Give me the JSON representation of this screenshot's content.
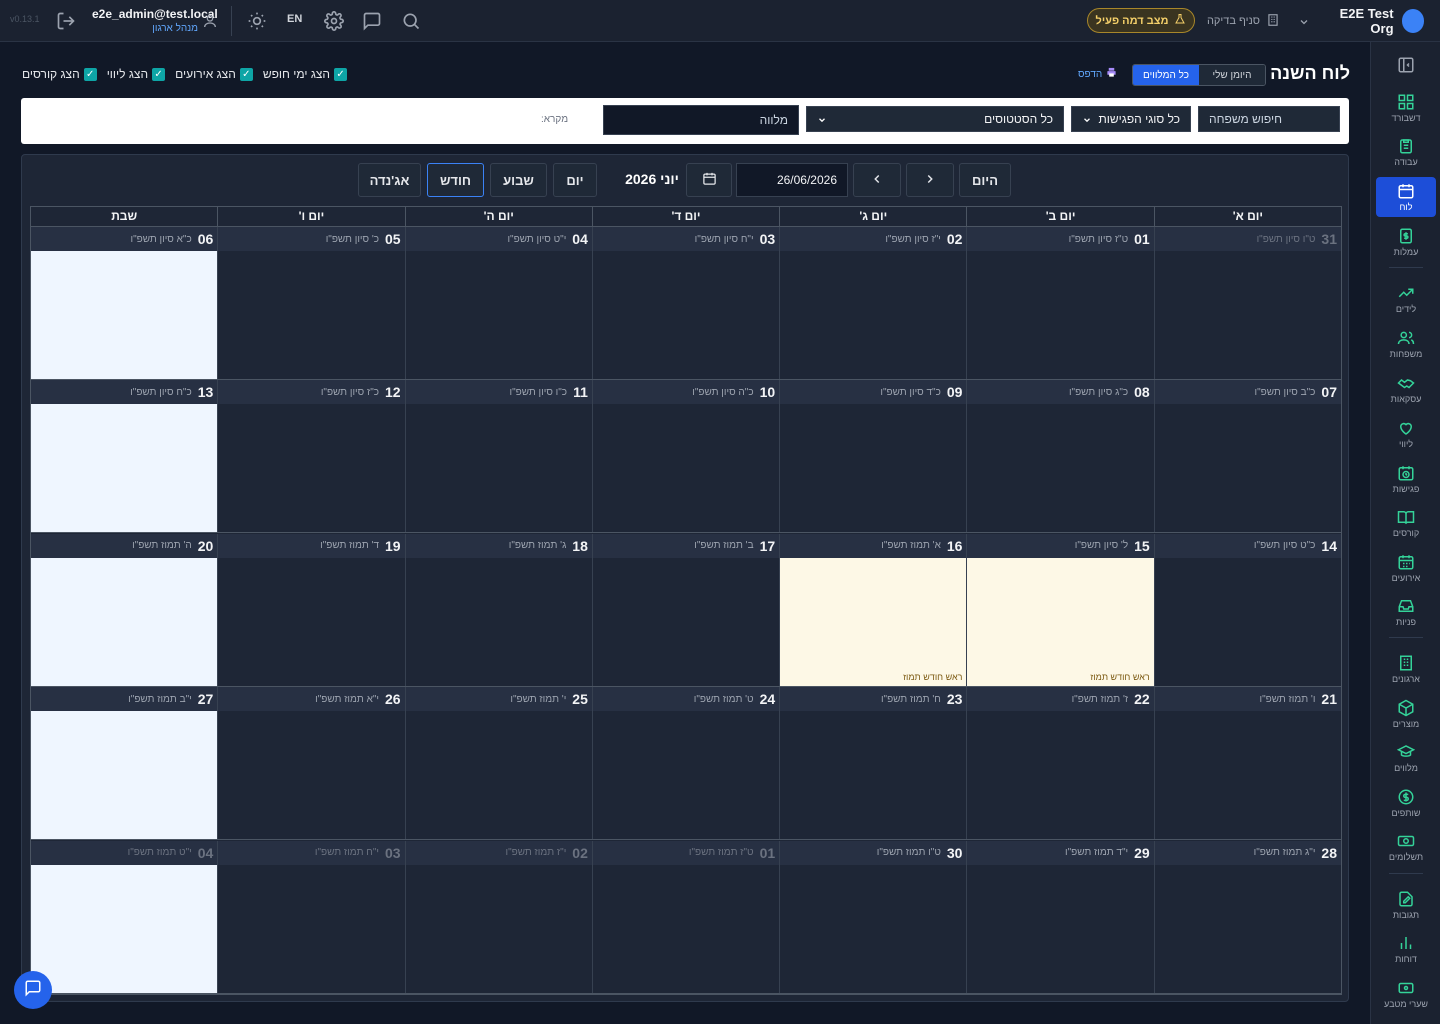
{
  "topbar": {
    "version": "v0.13.1",
    "user_email": "e2e_admin@test.local",
    "user_role": "מנהל ארגון",
    "lang": "EN",
    "demo_mode": "מצב דמה פעיל",
    "branch": "סניף בדיקה",
    "org_name": "E2E Test Org"
  },
  "sidebar": {
    "items": [
      {
        "label": "דשבורד",
        "icon": "dashboard-icon"
      },
      {
        "label": "עבודה",
        "icon": "clipboard-icon"
      },
      {
        "label": "לוח",
        "icon": "calendar-icon",
        "active": true
      },
      {
        "label": "עמלות",
        "icon": "dollar-doc-icon"
      },
      {
        "label": "לידים",
        "icon": "trending-icon"
      },
      {
        "label": "משפחות",
        "icon": "users-icon"
      },
      {
        "label": "עסקאות",
        "icon": "handshake-icon"
      },
      {
        "label": "ליווי",
        "icon": "heart-hand-icon"
      },
      {
        "label": "פגישות",
        "icon": "calendar-clock-icon"
      },
      {
        "label": "קורסים",
        "icon": "book-icon"
      },
      {
        "label": "אירועים",
        "icon": "calendar-grid-icon"
      },
      {
        "label": "פניות",
        "icon": "inbox-icon"
      },
      {
        "label": "ארגונים",
        "icon": "building-icon"
      },
      {
        "label": "מוצרים",
        "icon": "box-icon"
      },
      {
        "label": "מלווים",
        "icon": "graduation-cap-icon"
      },
      {
        "label": "שותפים",
        "icon": "coin-icon"
      },
      {
        "label": "תשלומים",
        "icon": "money-icon"
      },
      {
        "label": "תגובות",
        "icon": "edit-doc-icon"
      },
      {
        "label": "דוחות",
        "icon": "bar-chart-icon"
      },
      {
        "label": "שערי מטבע",
        "icon": "cash-icon"
      }
    ]
  },
  "header": {
    "title": "לוח השנה",
    "view_mine": "היומן שלי",
    "view_all": "כל המלווים",
    "print": "הדפס",
    "toggles": [
      "הצג ימי חופש",
      "הצג אירועים",
      "הצג ליווי",
      "הצג קורסים"
    ]
  },
  "filters": {
    "family_search_placeholder": "חיפוש משפחה",
    "meeting_types": "כל סוגי הפגישות",
    "statuses": "כל הסטטוסים",
    "escort_placeholder": "מלווה",
    "legend_label": "מקרא:"
  },
  "calendar": {
    "today": "היום",
    "date_value": "26/06/2026",
    "title": "יוני 2026",
    "views": {
      "day": "יום",
      "week": "שבוע",
      "month": "חודש",
      "agenda": "אג'נדה"
    },
    "active_view": "month",
    "day_headers": [
      "יום א'",
      "יום ב'",
      "יום ג'",
      "יום ד'",
      "יום ה'",
      "יום ו'",
      "שבת"
    ],
    "weeks": [
      [
        {
          "num": "31",
          "heb": "ט\"ו סיון תשפ\"ו",
          "out": true
        },
        {
          "num": "01",
          "heb": "ט\"ז סיון תשפ\"ו"
        },
        {
          "num": "02",
          "heb": "י\"ז סיון תשפ\"ו"
        },
        {
          "num": "03",
          "heb": "י\"ח סיון תשפ\"ו"
        },
        {
          "num": "04",
          "heb": "י\"ט סיון תשפ\"ו"
        },
        {
          "num": "05",
          "heb": "כ' סיון תשפ\"ו"
        },
        {
          "num": "06",
          "heb": "כ\"א סיון תשפ\"ו"
        }
      ],
      [
        {
          "num": "07",
          "heb": "כ\"ב סיון תשפ\"ו"
        },
        {
          "num": "08",
          "heb": "כ\"ג סיון תשפ\"ו"
        },
        {
          "num": "09",
          "heb": "כ\"ד סיון תשפ\"ו"
        },
        {
          "num": "10",
          "heb": "כ\"ה סיון תשפ\"ו"
        },
        {
          "num": "11",
          "heb": "כ\"ו סיון תשפ\"ו"
        },
        {
          "num": "12",
          "heb": "כ\"ז סיון תשפ\"ו"
        },
        {
          "num": "13",
          "heb": "כ\"ח סיון תשפ\"ו"
        }
      ],
      [
        {
          "num": "14",
          "heb": "כ\"ט סיון תשפ\"ו"
        },
        {
          "num": "15",
          "heb": "ל' סיון תשפ\"ו",
          "event": "ראש חודש תמוז"
        },
        {
          "num": "16",
          "heb": "א' תמוז תשפ\"ו",
          "event": "ראש חודש תמוז"
        },
        {
          "num": "17",
          "heb": "ב' תמוז תשפ\"ו"
        },
        {
          "num": "18",
          "heb": "ג' תמוז תשפ\"ו"
        },
        {
          "num": "19",
          "heb": "ד' תמוז תשפ\"ו"
        },
        {
          "num": "20",
          "heb": "ה' תמוז תשפ\"ו"
        }
      ],
      [
        {
          "num": "21",
          "heb": "ו' תמוז תשפ\"ו"
        },
        {
          "num": "22",
          "heb": "ז' תמוז תשפ\"ו"
        },
        {
          "num": "23",
          "heb": "ח' תמוז תשפ\"ו"
        },
        {
          "num": "24",
          "heb": "ט' תמוז תשפ\"ו"
        },
        {
          "num": "25",
          "heb": "י' תמוז תשפ\"ו"
        },
        {
          "num": "26",
          "heb": "י\"א תמוז תשפ\"ו"
        },
        {
          "num": "27",
          "heb": "י\"ב תמוז תשפ\"ו"
        }
      ],
      [
        {
          "num": "28",
          "heb": "י\"ג תמוז תשפ\"ו"
        },
        {
          "num": "29",
          "heb": "י\"ד תמוז תשפ\"ו"
        },
        {
          "num": "30",
          "heb": "ט\"ו תמוז תשפ\"ו"
        },
        {
          "num": "01",
          "heb": "ט\"ז תמוז תשפ\"ו",
          "out": true
        },
        {
          "num": "02",
          "heb": "י\"ז תמוז תשפ\"ו",
          "out": true
        },
        {
          "num": "03",
          "heb": "י\"ח תמוז תשפ\"ו",
          "out": true
        },
        {
          "num": "04",
          "heb": "י\"ט תמוז תשפ\"ו",
          "out": true
        }
      ]
    ]
  },
  "colors": {
    "accent": "#2563eb",
    "saturday_bg": "#eff6ff",
    "holiday_bg": "#fdf8e6"
  }
}
